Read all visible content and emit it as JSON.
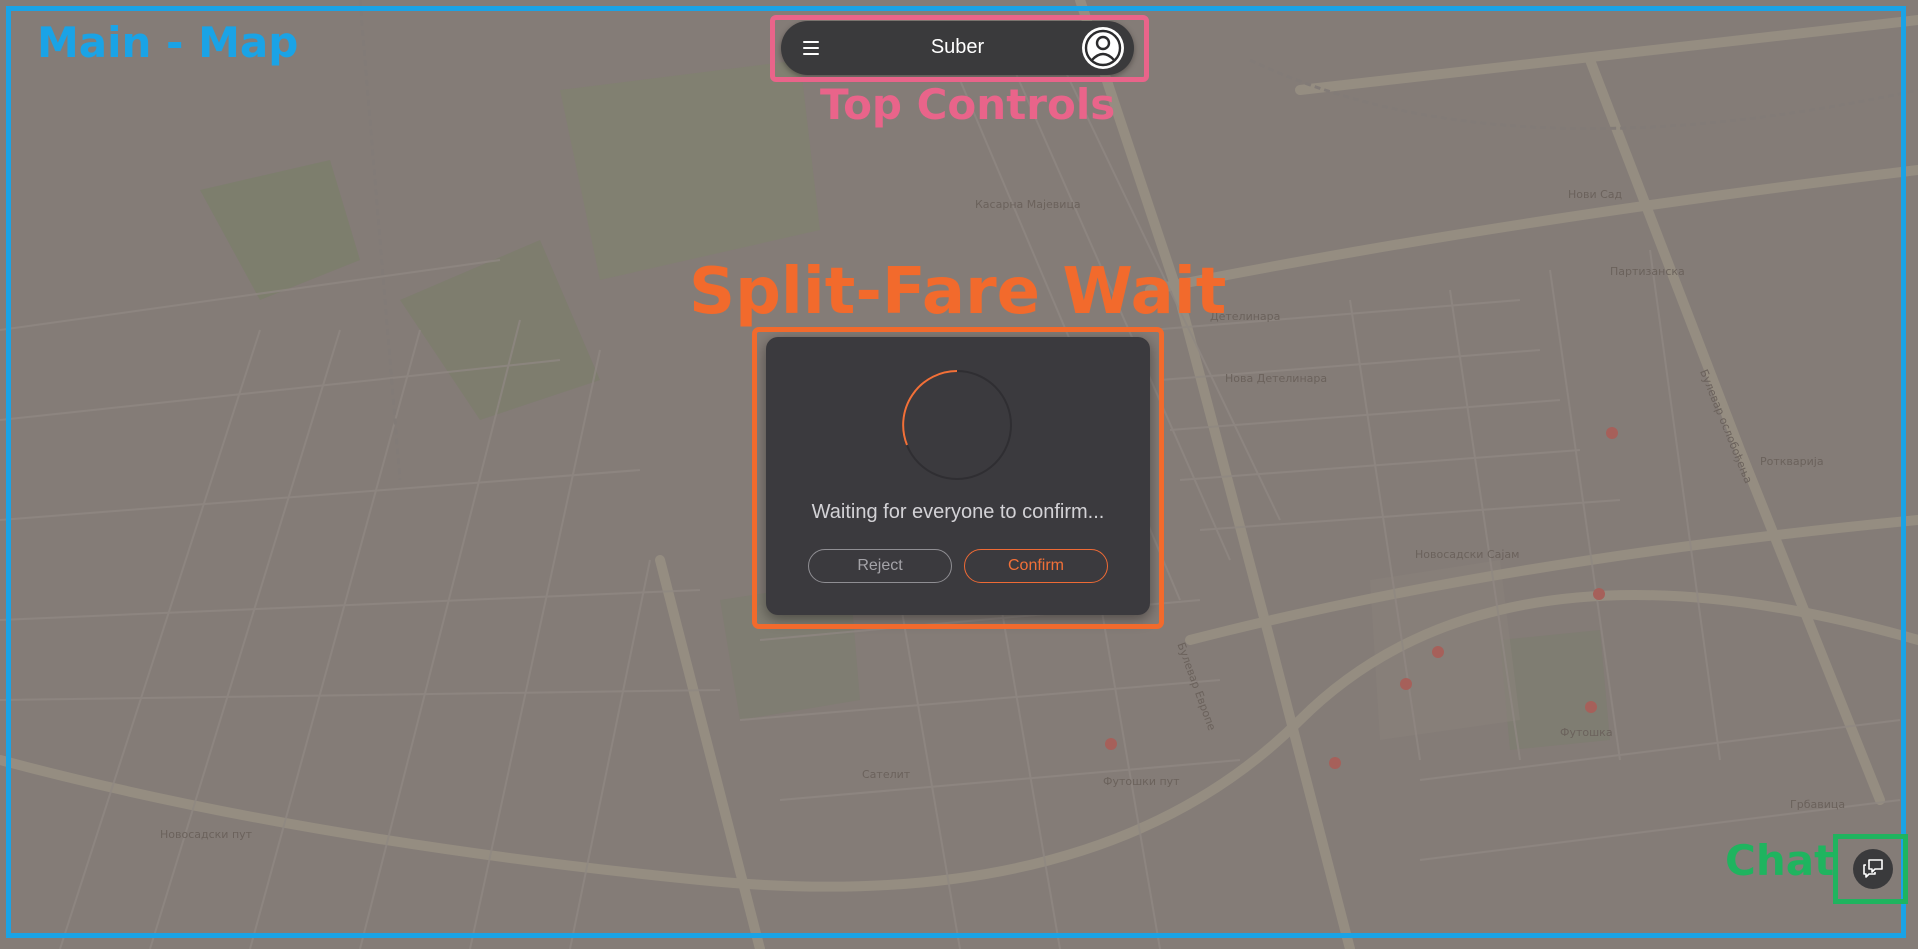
{
  "annotations": {
    "map": "Main - Map",
    "top_controls": "Top Controls",
    "split_fare": "Split-Fare Wait",
    "chat": "Chat"
  },
  "topbar": {
    "title": "Suber",
    "menu_icon": "hamburger-menu-icon",
    "avatar_icon": "user-avatar-icon"
  },
  "modal": {
    "message": "Waiting for everyone to confirm...",
    "reject_label": "Reject",
    "confirm_label": "Confirm",
    "spinner_color": "#f27038"
  },
  "chat": {
    "icon": "chat-bubbles-icon"
  },
  "map": {
    "labels": {
      "kasarna": "Касарна Мајевица",
      "detelinara": "Детелинара",
      "nova_detelinara": "Нова Детелинара",
      "satelit": "Сателит",
      "novi_sad": "Нови Сад",
      "novosadski_sajam": "Новосадски Сајам",
      "grbavica": "Грбавица",
      "rotkvarija": "Ротквариja",
      "futoski_put": "Футошки пут",
      "futoska": "Футошка",
      "bulevar_oslobodjenja": "Булевар ослобођења",
      "bulevar_evrope": "Булевар Европе",
      "novosadski_put": "Новосадски пут",
      "partizanska": "Партизанска"
    }
  },
  "colors": {
    "annot_map": "#1aa3e6",
    "annot_top": "#e9648a",
    "annot_split": "#f26a2c",
    "annot_chat": "#1fb45f",
    "panel": "#3a3a3c"
  }
}
